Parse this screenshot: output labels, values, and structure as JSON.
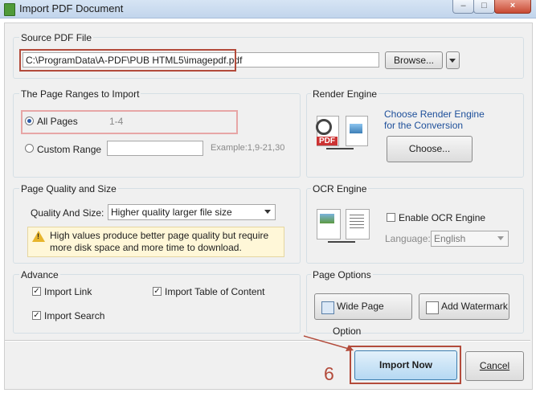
{
  "window": {
    "title": "Import PDF Document"
  },
  "source": {
    "group_label": "Source PDF File",
    "path": "C:\\ProgramData\\A-PDF\\PUB HTML5\\imagepdf.pdf",
    "browse_label": "Browse..."
  },
  "page_ranges": {
    "group_label": "The Page Ranges to Import",
    "all_pages_label": "All Pages",
    "all_pages_range": "1-4",
    "custom_label": "Custom Range",
    "custom_value": "",
    "example": "Example:1,9-21,30"
  },
  "render": {
    "group_label": "Render Engine",
    "desc": "Choose Render Engine\nfor the Conversion",
    "choose_label": "Choose...",
    "pdf_tag": "PDF"
  },
  "quality": {
    "group_label": "Page Quality and Size",
    "field_label": "Quality And Size:",
    "selected": "Higher quality larger file size",
    "warning": "High values produce better page quality but require more disk space and more time to download."
  },
  "ocr": {
    "group_label": "OCR Engine",
    "enable_label": "Enable OCR Engine",
    "language_label": "Language:",
    "language_value": "English"
  },
  "advance": {
    "group_label": "Advance",
    "import_link": "Import Link",
    "import_toc": "Import Table of Content",
    "import_search": "Import Search"
  },
  "page_options": {
    "group_label": "Page Options",
    "wide_label": "Wide Page Option",
    "watermark_label": "Add Watermark"
  },
  "footer": {
    "import_label": "Import Now",
    "cancel_label": "Cancel",
    "step_number": "6"
  },
  "colors": {
    "highlight": "#b34b3b",
    "link_blue": "#1d4f9a",
    "warning_bg": "#fff7d8"
  }
}
